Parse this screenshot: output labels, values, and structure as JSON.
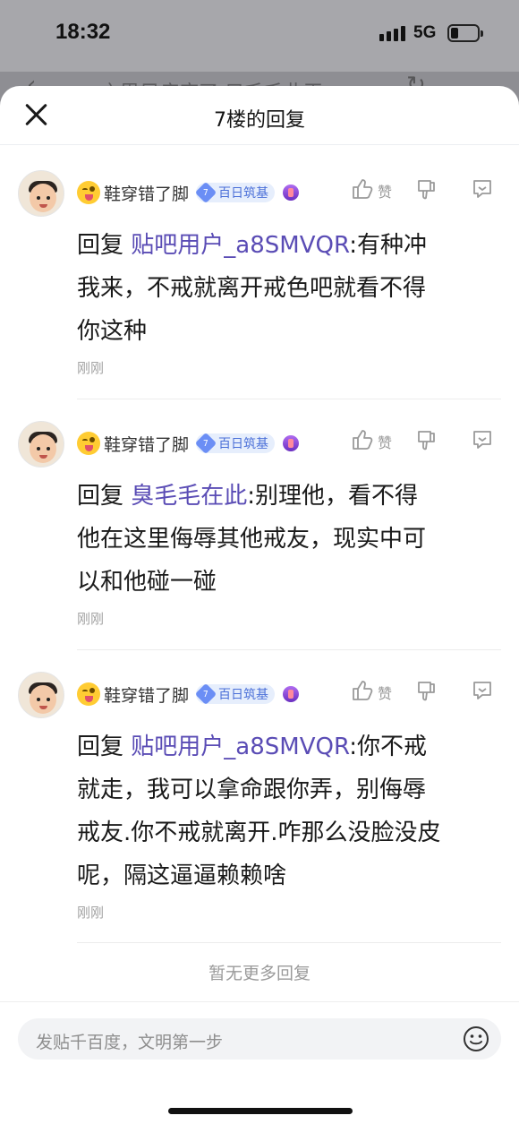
{
  "status": {
    "time": "18:32",
    "network": "5G"
  },
  "background_page": {
    "title": "…之思足痛府了 只毛毛此王…"
  },
  "sheet": {
    "title": "7楼的回复"
  },
  "replies": [
    {
      "username": "鞋穿错了脚",
      "level": "7",
      "level_title": "百日筑基",
      "like_label": "赞",
      "prefix": "回复",
      "mention": "贴吧用户_a8SMVQR",
      "lines": [
        ":有种冲",
        "我来，不戒就离开戒色吧就看不得",
        "你这种"
      ],
      "time": "刚刚"
    },
    {
      "username": "鞋穿错了脚",
      "level": "7",
      "level_title": "百日筑基",
      "like_label": "赞",
      "prefix": "回复",
      "mention": "臭毛毛在此",
      "lines": [
        ":别理他，看不得",
        "他在这里侮辱其他戒友，现实中可",
        "以和他碰一碰"
      ],
      "time": "刚刚"
    },
    {
      "username": "鞋穿错了脚",
      "level": "7",
      "level_title": "百日筑基",
      "like_label": "赞",
      "prefix": "回复",
      "mention": "贴吧用户_a8SMVQR",
      "lines": [
        ":你不戒",
        "就走，我可以拿命跟你弄，别侮辱",
        "戒友.你不戒就离开.咋那么没脸没皮",
        "呢，隔这逼逼赖赖啥"
      ],
      "time": "刚刚"
    }
  ],
  "footer": {
    "no_more": "暂无更多回复"
  },
  "input": {
    "placeholder": "发贴千百度，文明第一步"
  },
  "colors": {
    "mention": "#5a4cb5",
    "level_badge": "#6b8ef5",
    "muted": "#a3a3a3"
  }
}
